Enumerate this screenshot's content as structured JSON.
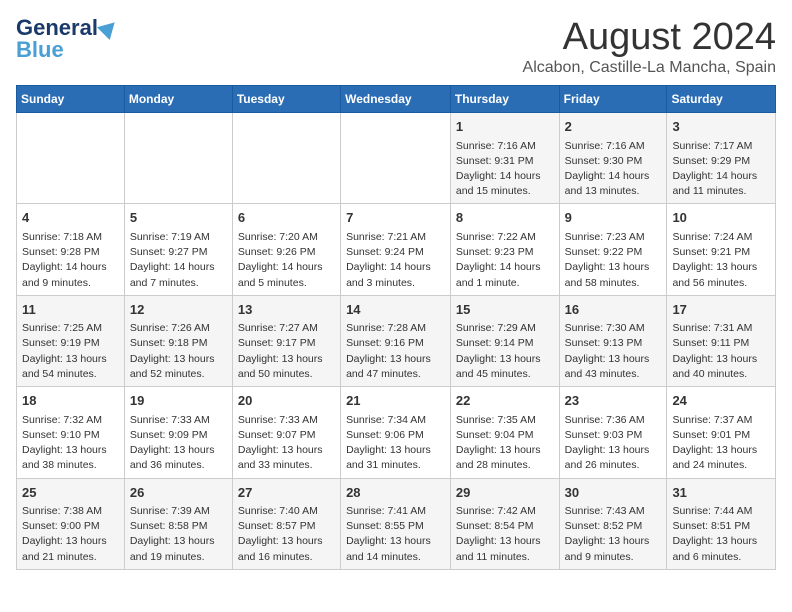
{
  "logo": {
    "line1": "General",
    "line2": "Blue"
  },
  "title": "August 2024",
  "subtitle": "Alcabon, Castille-La Mancha, Spain",
  "days_of_week": [
    "Sunday",
    "Monday",
    "Tuesday",
    "Wednesday",
    "Thursday",
    "Friday",
    "Saturday"
  ],
  "weeks": [
    [
      {
        "day": "",
        "info": ""
      },
      {
        "day": "",
        "info": ""
      },
      {
        "day": "",
        "info": ""
      },
      {
        "day": "",
        "info": ""
      },
      {
        "day": "1",
        "info": "Sunrise: 7:16 AM\nSunset: 9:31 PM\nDaylight: 14 hours\nand 15 minutes."
      },
      {
        "day": "2",
        "info": "Sunrise: 7:16 AM\nSunset: 9:30 PM\nDaylight: 14 hours\nand 13 minutes."
      },
      {
        "day": "3",
        "info": "Sunrise: 7:17 AM\nSunset: 9:29 PM\nDaylight: 14 hours\nand 11 minutes."
      }
    ],
    [
      {
        "day": "4",
        "info": "Sunrise: 7:18 AM\nSunset: 9:28 PM\nDaylight: 14 hours\nand 9 minutes."
      },
      {
        "day": "5",
        "info": "Sunrise: 7:19 AM\nSunset: 9:27 PM\nDaylight: 14 hours\nand 7 minutes."
      },
      {
        "day": "6",
        "info": "Sunrise: 7:20 AM\nSunset: 9:26 PM\nDaylight: 14 hours\nand 5 minutes."
      },
      {
        "day": "7",
        "info": "Sunrise: 7:21 AM\nSunset: 9:24 PM\nDaylight: 14 hours\nand 3 minutes."
      },
      {
        "day": "8",
        "info": "Sunrise: 7:22 AM\nSunset: 9:23 PM\nDaylight: 14 hours\nand 1 minute."
      },
      {
        "day": "9",
        "info": "Sunrise: 7:23 AM\nSunset: 9:22 PM\nDaylight: 13 hours\nand 58 minutes."
      },
      {
        "day": "10",
        "info": "Sunrise: 7:24 AM\nSunset: 9:21 PM\nDaylight: 13 hours\nand 56 minutes."
      }
    ],
    [
      {
        "day": "11",
        "info": "Sunrise: 7:25 AM\nSunset: 9:19 PM\nDaylight: 13 hours\nand 54 minutes."
      },
      {
        "day": "12",
        "info": "Sunrise: 7:26 AM\nSunset: 9:18 PM\nDaylight: 13 hours\nand 52 minutes."
      },
      {
        "day": "13",
        "info": "Sunrise: 7:27 AM\nSunset: 9:17 PM\nDaylight: 13 hours\nand 50 minutes."
      },
      {
        "day": "14",
        "info": "Sunrise: 7:28 AM\nSunset: 9:16 PM\nDaylight: 13 hours\nand 47 minutes."
      },
      {
        "day": "15",
        "info": "Sunrise: 7:29 AM\nSunset: 9:14 PM\nDaylight: 13 hours\nand 45 minutes."
      },
      {
        "day": "16",
        "info": "Sunrise: 7:30 AM\nSunset: 9:13 PM\nDaylight: 13 hours\nand 43 minutes."
      },
      {
        "day": "17",
        "info": "Sunrise: 7:31 AM\nSunset: 9:11 PM\nDaylight: 13 hours\nand 40 minutes."
      }
    ],
    [
      {
        "day": "18",
        "info": "Sunrise: 7:32 AM\nSunset: 9:10 PM\nDaylight: 13 hours\nand 38 minutes."
      },
      {
        "day": "19",
        "info": "Sunrise: 7:33 AM\nSunset: 9:09 PM\nDaylight: 13 hours\nand 36 minutes."
      },
      {
        "day": "20",
        "info": "Sunrise: 7:33 AM\nSunset: 9:07 PM\nDaylight: 13 hours\nand 33 minutes."
      },
      {
        "day": "21",
        "info": "Sunrise: 7:34 AM\nSunset: 9:06 PM\nDaylight: 13 hours\nand 31 minutes."
      },
      {
        "day": "22",
        "info": "Sunrise: 7:35 AM\nSunset: 9:04 PM\nDaylight: 13 hours\nand 28 minutes."
      },
      {
        "day": "23",
        "info": "Sunrise: 7:36 AM\nSunset: 9:03 PM\nDaylight: 13 hours\nand 26 minutes."
      },
      {
        "day": "24",
        "info": "Sunrise: 7:37 AM\nSunset: 9:01 PM\nDaylight: 13 hours\nand 24 minutes."
      }
    ],
    [
      {
        "day": "25",
        "info": "Sunrise: 7:38 AM\nSunset: 9:00 PM\nDaylight: 13 hours\nand 21 minutes."
      },
      {
        "day": "26",
        "info": "Sunrise: 7:39 AM\nSunset: 8:58 PM\nDaylight: 13 hours\nand 19 minutes."
      },
      {
        "day": "27",
        "info": "Sunrise: 7:40 AM\nSunset: 8:57 PM\nDaylight: 13 hours\nand 16 minutes."
      },
      {
        "day": "28",
        "info": "Sunrise: 7:41 AM\nSunset: 8:55 PM\nDaylight: 13 hours\nand 14 minutes."
      },
      {
        "day": "29",
        "info": "Sunrise: 7:42 AM\nSunset: 8:54 PM\nDaylight: 13 hours\nand 11 minutes."
      },
      {
        "day": "30",
        "info": "Sunrise: 7:43 AM\nSunset: 8:52 PM\nDaylight: 13 hours\nand 9 minutes."
      },
      {
        "day": "31",
        "info": "Sunrise: 7:44 AM\nSunset: 8:51 PM\nDaylight: 13 hours\nand 6 minutes."
      }
    ]
  ]
}
